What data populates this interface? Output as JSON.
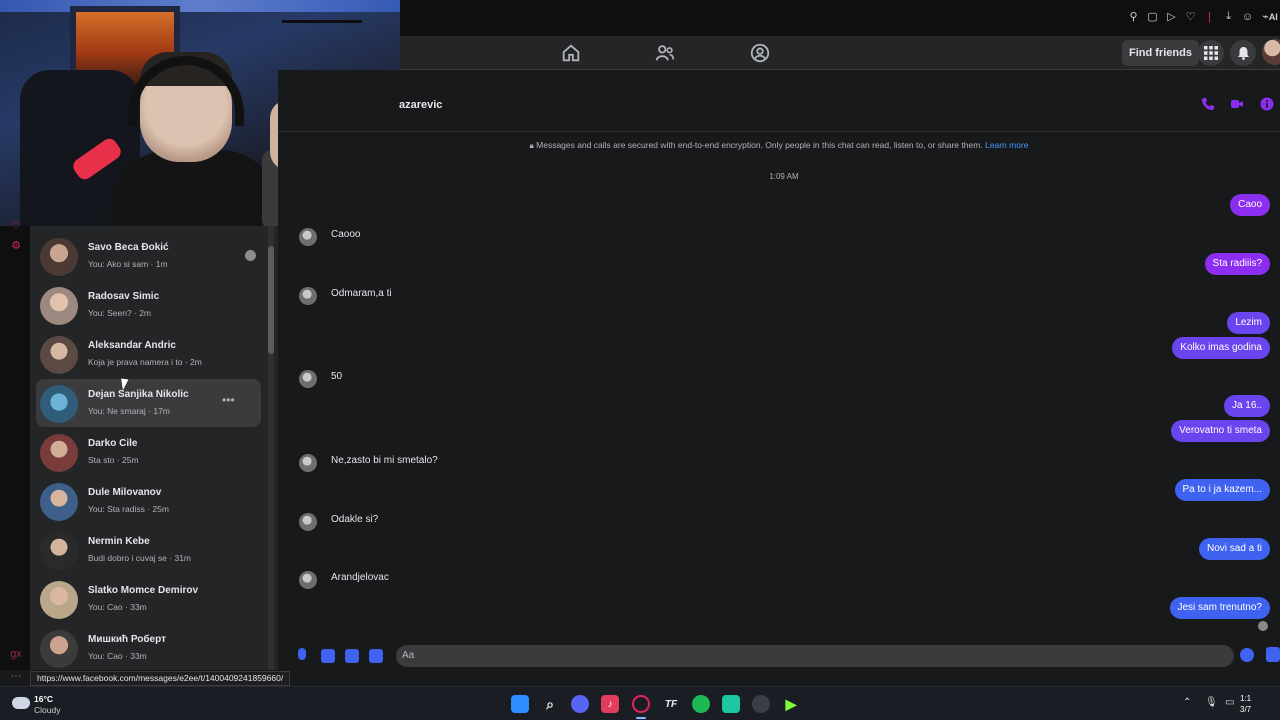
{
  "browser": {
    "toolbar_icons": [
      "bookmark-icon",
      "window-icon",
      "play-icon",
      "heart-icon",
      "record-icon",
      "download-icon",
      "profile-icon",
      "ai-icon"
    ],
    "ai_label": "AI"
  },
  "nav": {
    "find_friends": "Find friends",
    "icons": [
      "home-icon",
      "friends-icon",
      "groups-icon",
      "menu-grid-icon",
      "bell-icon"
    ]
  },
  "conversation": {
    "name": "azarevic",
    "encryption_notice": "Messages and calls are secured with end-to-end encryption. Only people in this chat can read, listen to, or share them.",
    "learn_more": "Learn more",
    "timestamp": "1:09 AM",
    "incoming": [
      {
        "text": "Caooo"
      },
      {
        "text": "Odmaram,a ti"
      },
      {
        "text": "50"
      },
      {
        "text": "Ne,zasto bi mi smetalo?"
      },
      {
        "text": "Odakle si?"
      },
      {
        "text": "Arandjelovac"
      }
    ],
    "outgoing": [
      {
        "text": "Caoo"
      },
      {
        "text": "Sta radiiis?"
      },
      {
        "text": "Lezim"
      },
      {
        "text": "Kolko imas godina"
      },
      {
        "text": "Ja 16.."
      },
      {
        "text": "Verovatno ti smeta"
      },
      {
        "text": "Pa to i ja kazem..."
      },
      {
        "text": "Novi sad a ti"
      },
      {
        "text": "Jesi sam trenutno?"
      }
    ],
    "composer_placeholder": "Aa",
    "accent_color": "#8c2ef0"
  },
  "chats": [
    {
      "name": "Savo Beca Đokić",
      "preview": "You: Ako si sam · 1m"
    },
    {
      "name": "Radosav Simic",
      "preview": "You: Seen? · 2m"
    },
    {
      "name": "Aleksandar Andric",
      "preview": "Koja je prava namera i to · 2m"
    },
    {
      "name": "Dejan Sanjika Nikolic",
      "preview": "You: Ne smaraj · 17m"
    },
    {
      "name": "Darko Cile",
      "preview": "Sta sto · 25m"
    },
    {
      "name": "Dule Milovanov",
      "preview": "You: Sta radiss · 25m"
    },
    {
      "name": "Nermin Kebe",
      "preview": "Budi dobro i cuvaj se · 31m"
    },
    {
      "name": "Slatko Momce Demirov",
      "preview": "You: Cao · 33m"
    },
    {
      "name": "Мишкић Роберт",
      "preview": "You: Cao · 33m"
    }
  ],
  "status_url": "https://www.facebook.com/messages/e2ee/t/1400409241859660/",
  "taskbar": {
    "temperature": "16°C",
    "weather": "Cloudy",
    "apps": [
      "windows-start-icon",
      "search-icon",
      "discord-icon",
      "tiktok-icon",
      "opera-gx-icon",
      "tf-icon",
      "spotify-icon",
      "app-icon",
      "steam-icon",
      "game-icon"
    ],
    "time": "1:1",
    "date": "3/7"
  }
}
